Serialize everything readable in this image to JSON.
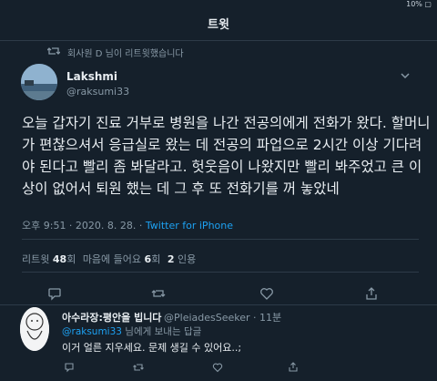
{
  "status": {
    "right": "10% ▢"
  },
  "header": {
    "title": "트윗"
  },
  "retweet": {
    "text": "회사원 D 님이 리트윗했습니다"
  },
  "tweet": {
    "name": "Lakshmi",
    "handle": "@raksumi33",
    "text": "오늘 갑자기 진료 거부로 병원을 나간 전공의에게 전화가 왔다. 할머니가 편찮으셔서 응급실로 왔는 데 전공의 파업으로 2시간 이상 기다려야 된다고 빨리 좀 봐달라고. 헛웃음이 나왔지만 빨리 봐주었고 큰 이상이 없어서 퇴원 했는 데 그 후 또 전화기를 꺼 놓았네",
    "time": "오후 9:51 · 2020. 8. 28. · ",
    "client": "Twitter for iPhone",
    "retweets_label": "리트윗",
    "retweets": "48",
    "retweets_suffix": "회",
    "likes_label": "마음에 들어요",
    "likes": "6",
    "likes_suffix": "회",
    "quotes": "2",
    "quotes_label": "인용"
  },
  "reply": {
    "name": "아수라장:평안을 빕니다",
    "handle": "@PleiadesSeeker · 11분",
    "to_mention": "@raksumi33",
    "to_suffix": " 님에게 보내는 답글",
    "text": "이거 얼른 지우세요. 문제 생길 수 있어요..;"
  }
}
